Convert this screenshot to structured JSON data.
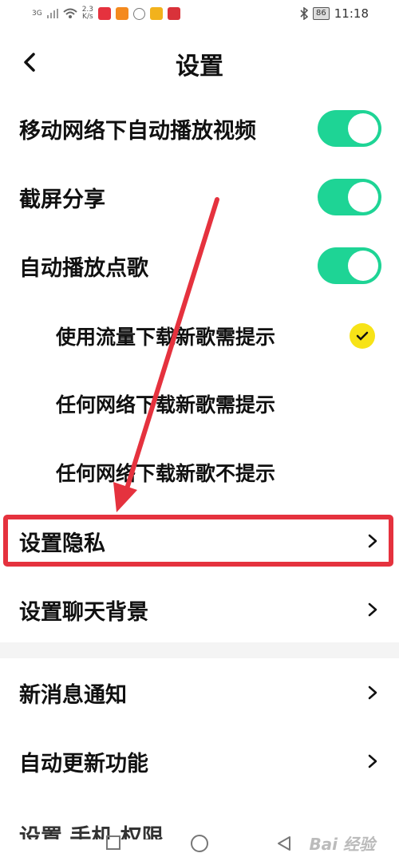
{
  "status_bar": {
    "signal": "3G",
    "speed_value": "2.3",
    "speed_unit": "K/s",
    "battery": "86",
    "time": "11:18"
  },
  "header": {
    "title": "设置"
  },
  "settings": {
    "autoplay_mobile": {
      "label": "移动网络下自动播放视频",
      "enabled": true
    },
    "screenshot_share": {
      "label": "截屏分享",
      "enabled": true
    },
    "autoplay_song": {
      "label": "自动播放点歌",
      "enabled": true
    },
    "download_options": [
      {
        "label": "使用流量下载新歌需提示",
        "selected": true
      },
      {
        "label": "任何网络下载新歌需提示",
        "selected": false
      },
      {
        "label": "任何网络下载新歌不提示",
        "selected": false
      }
    ],
    "privacy": {
      "label": "设置隐私"
    },
    "chat_background": {
      "label": "设置聊天背景"
    },
    "new_message": {
      "label": "新消息通知"
    },
    "auto_update": {
      "label": "自动更新功能"
    },
    "partial_next": {
      "label": "设置 手机 权限"
    }
  },
  "watermark": "Bai 经验",
  "colors": {
    "toggle_on": "#1ed495",
    "check": "#f7e317",
    "annotation": "#e5323e"
  }
}
